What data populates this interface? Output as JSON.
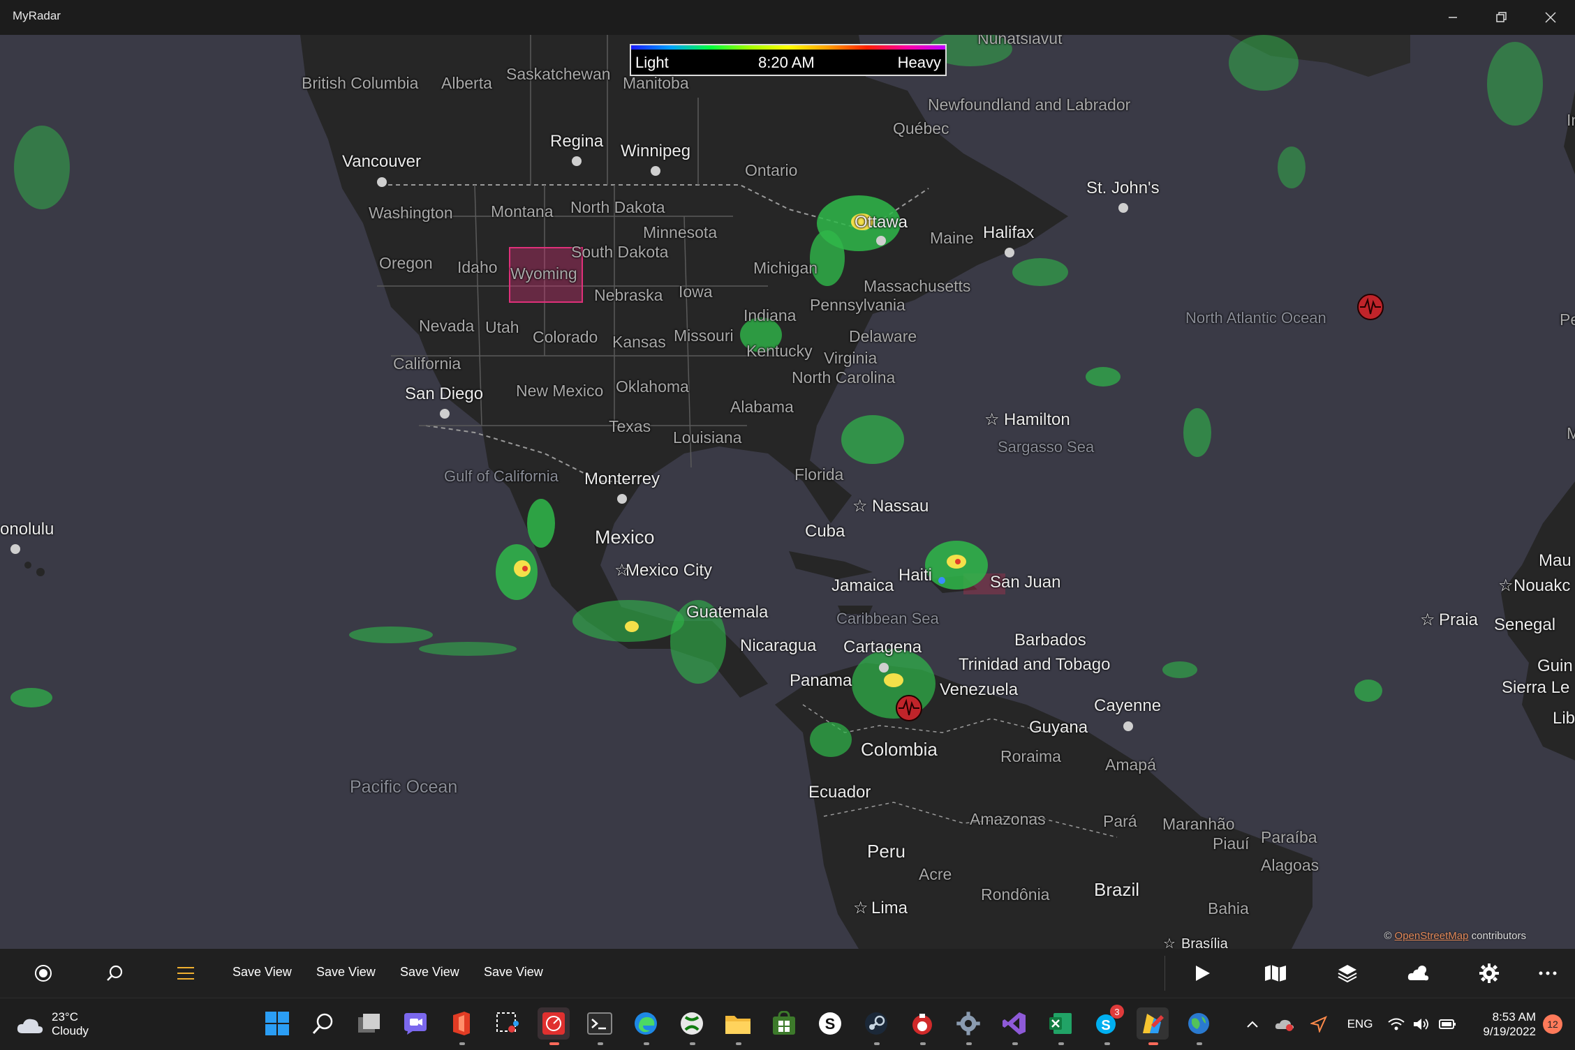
{
  "app": {
    "title": "MyRadar"
  },
  "legend": {
    "light": "Light",
    "time": "8:20 AM",
    "heavy": "Heavy"
  },
  "map": {
    "cities": [
      "Vancouver",
      "Regina",
      "Winnipeg",
      "San Diego",
      "Monterrey",
      "Mexico",
      "Mexico City",
      "Guatemala",
      "Nicaragua",
      "Cuba",
      "Jamaica",
      "Haiti",
      "San Juan",
      "Panama",
      "Cartagena",
      "Venezuela",
      "Colombia",
      "Ecuador",
      "Peru",
      "Lima",
      "Brazil",
      "Guyana",
      "Cayenne",
      "Barbados",
      "Trinidad and Tobago",
      "Nassau",
      "Hamilton",
      "St. John's",
      "Halifax",
      "Ottawa",
      "Praia",
      "Senegal",
      "onolulu",
      "Sierra Le",
      "Mau",
      "Nouakc",
      "Guin",
      "Lib",
      "Brasília"
    ],
    "regions": [
      "British Columbia",
      "Alberta",
      "Saskatchewan",
      "Manitoba",
      "Ontario",
      "Québec",
      "Newfoundland and Labrador",
      "Nunatsiavut",
      "Washington",
      "Montana",
      "North Dakota",
      "Minnesota",
      "South Dakota",
      "Oregon",
      "Idaho",
      "Wyoming",
      "Nebraska",
      "Iowa",
      "Michigan",
      "Massachusetts",
      "Pennsylvania",
      "Maine",
      "Nevada",
      "Utah",
      "Colorado",
      "Kansas",
      "Missouri",
      "Indiana",
      "Kentucky",
      "Virginia",
      "Delaware",
      "California",
      "New Mexico",
      "Oklahoma",
      "North Carolina",
      "Alabama",
      "Texas",
      "Louisiana",
      "Florida",
      "Amazonas",
      "Pará",
      "Maranhão",
      "Piauí",
      "Paraíba",
      "Alagoas",
      "Bahia",
      "Acre",
      "Rondônia",
      "Roraima",
      "Amapá",
      "Pe",
      "In",
      "M"
    ],
    "seas": [
      "Gulf of California",
      "Caribbean Sea",
      "Sargasso Sea"
    ],
    "oceans": [
      "Pacific Ocean",
      "North Atlantic Ocean"
    ],
    "attribution": {
      "prefix": "©",
      "link": "OpenStreetMap",
      "suffix": "contributors"
    }
  },
  "toolbar": {
    "save_views": [
      "Save View",
      "Save View",
      "Save View",
      "Save View"
    ],
    "icons": [
      "location-icon",
      "search-icon",
      "menu-icon",
      "play-icon",
      "map-icon",
      "layers-icon",
      "weather-icon",
      "settings-icon",
      "more-icon"
    ]
  },
  "taskbar": {
    "weather": {
      "temp": "23°C",
      "condition": "Cloudy"
    },
    "language": "ENG",
    "time": "8:53 AM",
    "date": "9/19/2022",
    "notifications": "12",
    "skype_badge": "3"
  },
  "colors": {
    "map_ocean": "#3a3a46",
    "map_land": "#262626",
    "accent": "#ff5a3c",
    "storm_pink": "#e0307a"
  }
}
